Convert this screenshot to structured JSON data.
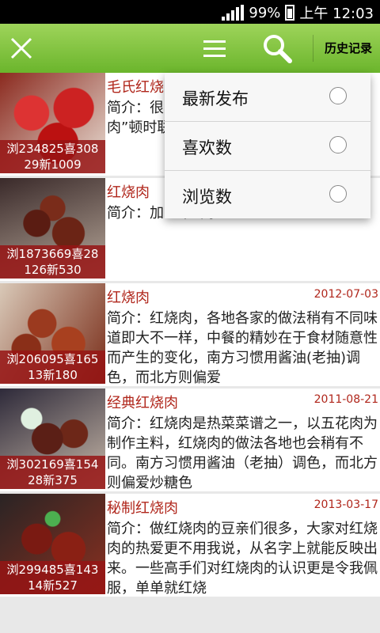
{
  "status_bar": {
    "battery": "99%",
    "time": "上午 12:03"
  },
  "app_bar": {
    "history_label": "历史记录"
  },
  "sort_menu": {
    "options": [
      "最新发布",
      "喜欢数",
      "浏览数"
    ]
  },
  "recipes": [
    {
      "title": "毛氏红烧肉",
      "date": "",
      "desc": "简介：很多人对红烧肉敬而远之，“红烧肉”顿时联想到高脂肪。",
      "stats_line1": "浏234825喜308",
      "stats_line2": "29新1009"
    },
    {
      "title": "红烧肉",
      "date": "",
      "desc": "简介：加…平“鹤”。",
      "stats_line1": "浏1873669喜28",
      "stats_line2": "126新530"
    },
    {
      "title": "红烧肉",
      "date": "2012-07-03",
      "desc": "简介：红烧肉，各地各家的做法稍有不同味道即大不一样，中餐的精妙在于食材随意性而产生的变化，南方习惯用酱油(老抽)调色，而北方则偏爱",
      "stats_line1": "浏206095喜165",
      "stats_line2": "13新180"
    },
    {
      "title": "经典红烧肉",
      "date": "2011-08-21",
      "desc": "简介：红烧肉是热菜菜谱之一，以五花肉为制作主料，红烧肉的做法各地也会稍有不同。南方习惯用酱油（老抽）调色，而北方则偏爱炒糖色",
      "stats_line1": "浏302169喜154",
      "stats_line2": "28新375"
    },
    {
      "title": "秘制红烧肉",
      "date": "2013-03-17",
      "desc": "简介：做红烧肉的豆亲们很多，大家对红烧肉的热爱更不用我说，从名字上就能反映出来。一些高手们对红烧肉的认识更是令我佩服，单单就红烧",
      "stats_line1": "浏299485喜143",
      "stats_line2": "14新527"
    }
  ]
}
